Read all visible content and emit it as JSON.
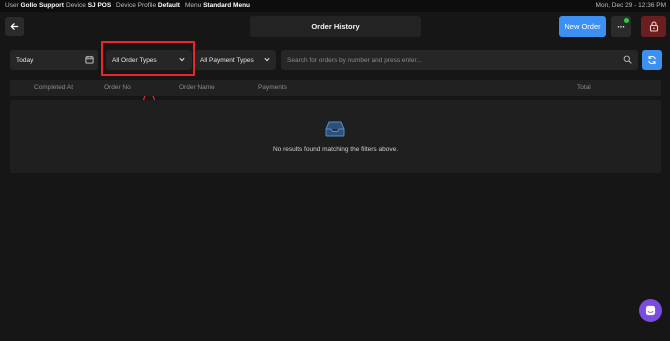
{
  "status_bar": {
    "user_label": "User",
    "user_value": "Gollo Support",
    "device_label": "Device",
    "device_value": "SJ POS",
    "profile_label": "Device Profile",
    "profile_value": "Default",
    "menu_label": "Menu",
    "menu_value": "Standard Menu",
    "datetime": "Mon, Dec 29 - 12:36 PM"
  },
  "header": {
    "back_icon": "arrow-left-icon",
    "title": "Order History",
    "new_order_label": "New Order",
    "more_icon": "more-dots-icon",
    "more_label": "···",
    "lock_icon": "lock-icon",
    "notification_color": "#2ecc40"
  },
  "filters": {
    "date_value": "Today",
    "date_icon": "calendar-icon",
    "order_type_value": "All Order Types",
    "payment_type_value": "All Payment Types",
    "search_placeholder": "Search for orders by number and press enter...",
    "search_icon": "search-icon",
    "refresh_icon": "refresh-icon"
  },
  "table": {
    "columns": [
      "Completed At",
      "Order No",
      "Order Name",
      "Payments",
      "Total"
    ],
    "rows": [],
    "empty_icon": "inbox-icon",
    "empty_message": "No results found matching the filters above."
  },
  "chat": {
    "icon": "chat-icon"
  },
  "annotation": {
    "highlight_color": "#e8262b"
  },
  "colors": {
    "accent": "#3d8ff2",
    "background": "#161616",
    "lock": "#6b1e1e",
    "chat": "#7a4de0"
  }
}
